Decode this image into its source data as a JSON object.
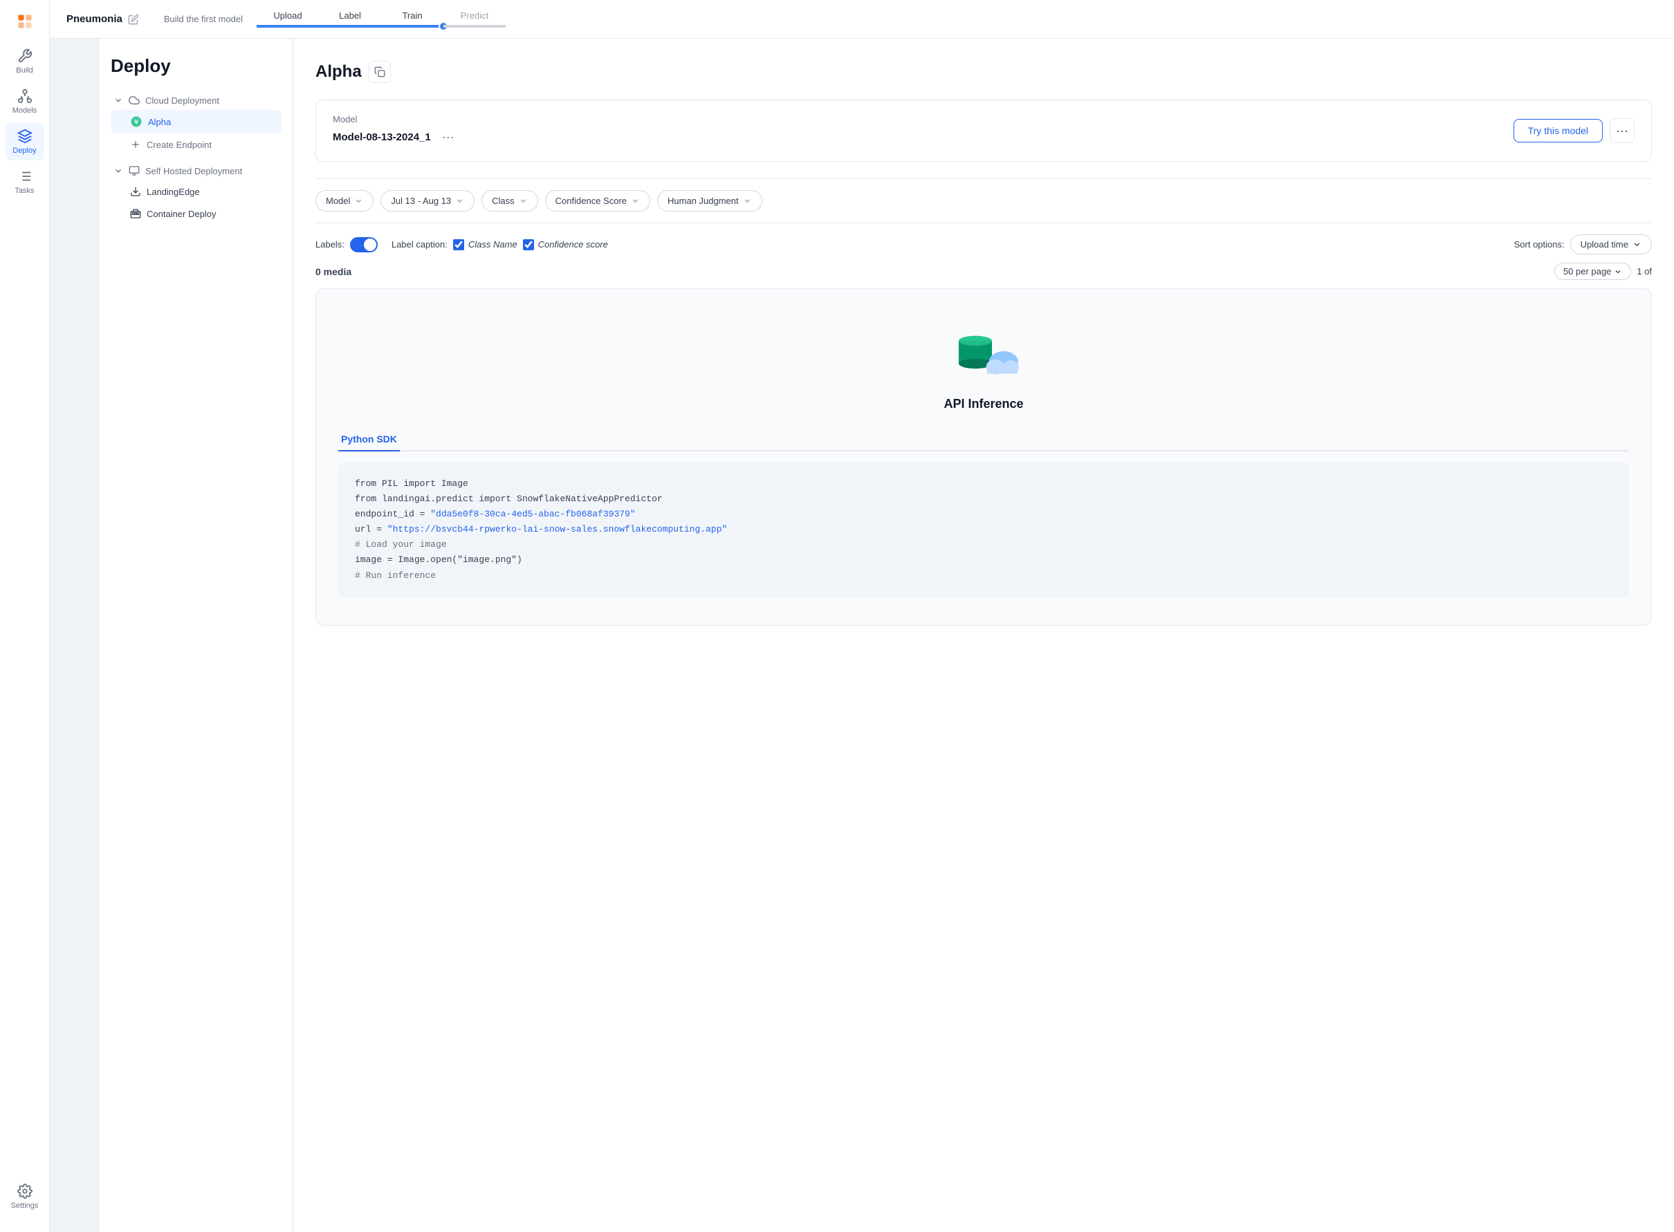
{
  "app": {
    "project_name": "Pneumonia",
    "edit_icon": "pencil-icon"
  },
  "header": {
    "pipeline_label": "Build the first model",
    "steps": [
      {
        "label": "Upload",
        "active": true
      },
      {
        "label": "Label",
        "active": true
      },
      {
        "label": "Train",
        "active": true
      },
      {
        "label": "Predict",
        "active": false
      }
    ]
  },
  "sidebar": {
    "page_title": "Deploy",
    "cloud_deployment": {
      "label": "Cloud Deployment",
      "items": [
        {
          "label": "Alpha",
          "active": true
        },
        {
          "label": "Create Endpoint",
          "is_create": true
        }
      ]
    },
    "self_hosted": {
      "label": "Self Hosted Deployment",
      "items": [
        {
          "label": "LandingEdge"
        },
        {
          "label": "Container Deploy"
        }
      ]
    }
  },
  "content": {
    "endpoint_title": "Alpha",
    "model_section": {
      "label": "Model",
      "model_name": "Model-08-13-2024_1",
      "try_model_btn": "Try this model"
    },
    "filters": [
      {
        "label": "Model",
        "has_dropdown": true
      },
      {
        "label": "Jul 13 - Aug 13",
        "has_dropdown": true
      },
      {
        "label": "Class",
        "has_dropdown": true
      },
      {
        "label": "Confidence Score",
        "has_dropdown": true
      },
      {
        "label": "Human Judgment",
        "has_dropdown": true
      }
    ],
    "labels_section": {
      "labels_label": "Labels:",
      "label_caption_label": "Label caption:",
      "class_name_label": "Class Name",
      "confidence_score_label": "Confidence score",
      "sort_options_label": "Sort options:",
      "sort_options_value": "Upload time"
    },
    "media_count": "0 media",
    "per_page": "50 per page",
    "page_info": "1 of",
    "api_section": {
      "title": "API Inference",
      "sdk_tab": "Python SDK",
      "code_lines": [
        {
          "text": "from PIL import Image",
          "type": "normal"
        },
        {
          "text": "from landingai.predict import SnowflakeNativeAppPredictor",
          "type": "normal"
        },
        {
          "text": "endpoint_id = ",
          "type": "normal",
          "link_text": "\"dda5e0f8-30ca-4ed5-abac-fb068af39379\"",
          "link": true
        },
        {
          "text": "url = ",
          "type": "normal",
          "link_text": "\"https://bsvcb44-rpwerko-lai-snow-sales.snowflakecomputing.app\"",
          "link": true
        },
        {
          "text": "# Load your image",
          "type": "comment"
        },
        {
          "text": "image = Image.open(\"image.png\")",
          "type": "normal"
        },
        {
          "text": "# Run inference",
          "type": "comment"
        }
      ]
    }
  },
  "nav_items": [
    {
      "label": "Build",
      "icon": "build-icon",
      "active": false
    },
    {
      "label": "Models",
      "icon": "models-icon",
      "active": false
    },
    {
      "label": "Deploy",
      "icon": "deploy-icon",
      "active": true
    },
    {
      "label": "Tasks",
      "icon": "tasks-icon",
      "active": false
    }
  ],
  "settings_label": "Settings"
}
